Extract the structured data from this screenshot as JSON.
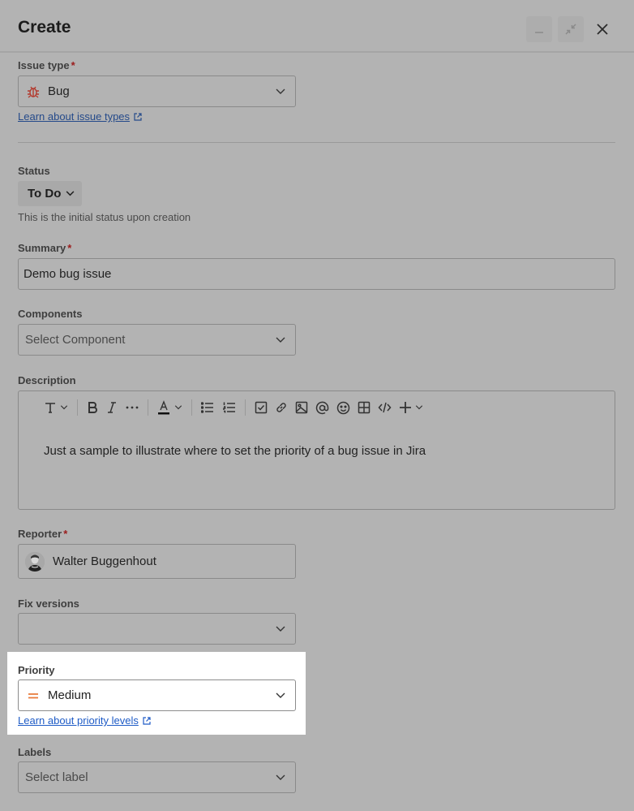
{
  "header": {
    "title": "Create",
    "minimize_icon": "minimize-icon",
    "collapse_icon": "collapse-icon",
    "close_icon": "close-icon"
  },
  "issue_type": {
    "label": "Issue type",
    "required": "*",
    "value": "Bug",
    "icon": "bug-icon",
    "icon_color": "#c0392b",
    "link": "Learn about issue types"
  },
  "status": {
    "label": "Status",
    "value": "To Do",
    "helper": "This is the initial status upon creation"
  },
  "summary": {
    "label": "Summary",
    "required": "*",
    "value": "Demo bug issue"
  },
  "components": {
    "label": "Components",
    "placeholder": "Select Component"
  },
  "description": {
    "label": "Description",
    "toolbar": [
      "text-style",
      "bold",
      "italic",
      "more",
      "text-color",
      "bullet-list",
      "numbered-list",
      "action-item",
      "link",
      "image",
      "mention",
      "emoji",
      "table",
      "code",
      "insert"
    ],
    "value": "Just a sample to illustrate where to set the priority of a bug issue in Jira"
  },
  "reporter": {
    "label": "Reporter",
    "required": "*",
    "value": "Walter Buggenhout"
  },
  "fix_versions": {
    "label": "Fix versions",
    "value": ""
  },
  "priority": {
    "label": "Priority",
    "value": "Medium",
    "icon": "priority-medium-icon",
    "icon_color": "#e8793a",
    "link": "Learn about priority levels"
  },
  "labels": {
    "label": "Labels",
    "placeholder": "Select label"
  }
}
